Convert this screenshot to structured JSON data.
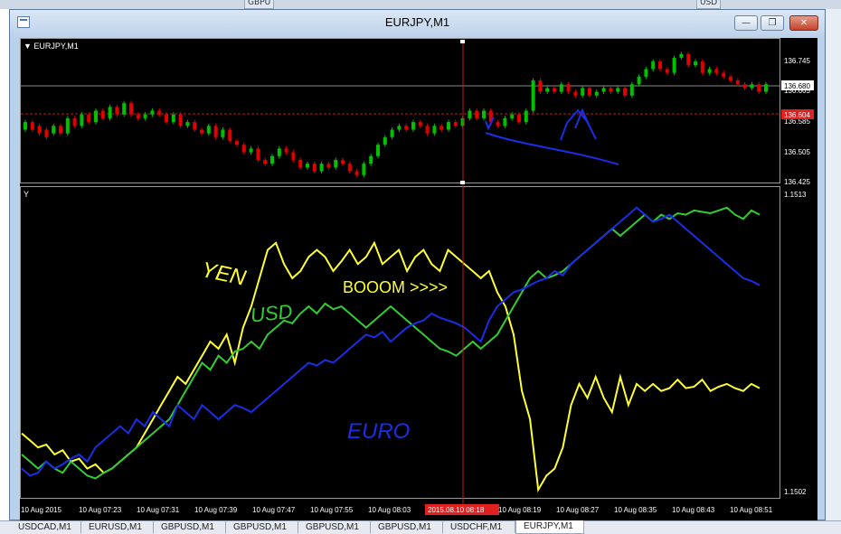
{
  "background_windows": [
    {
      "label": "GBPU"
    },
    {
      "label": "USD"
    }
  ],
  "window": {
    "title": "EURJPY,M1",
    "buttons": {
      "minimize": "—",
      "restore": "❐",
      "close": "✕"
    }
  },
  "price_chart": {
    "label": "▼ EURJPY,M1",
    "bid_label": "136.680",
    "ask_label": "136.604",
    "price_axis": [
      "136.745",
      "136.665",
      "136.585",
      "136.505",
      "136.425"
    ],
    "candles": [
      [
        136.56,
        136.58
      ],
      [
        136.58,
        136.56
      ],
      [
        136.57,
        136.55
      ],
      [
        136.56,
        136.54
      ],
      [
        136.55,
        136.57
      ],
      [
        136.57,
        136.55
      ],
      [
        136.55,
        136.59
      ],
      [
        136.59,
        136.57
      ],
      [
        136.57,
        136.6
      ],
      [
        136.6,
        136.58
      ],
      [
        136.58,
        136.61
      ],
      [
        136.61,
        136.59
      ],
      [
        136.59,
        136.62
      ],
      [
        136.62,
        136.6
      ],
      [
        136.6,
        136.63
      ],
      [
        136.63,
        136.6
      ],
      [
        136.6,
        136.59
      ],
      [
        136.59,
        136.6
      ],
      [
        136.6,
        136.61
      ],
      [
        136.61,
        136.6
      ],
      [
        136.6,
        136.58
      ],
      [
        136.58,
        136.6
      ],
      [
        136.6,
        136.57
      ],
      [
        136.57,
        136.58
      ],
      [
        136.58,
        136.56
      ],
      [
        136.56,
        136.55
      ],
      [
        136.55,
        136.57
      ],
      [
        136.57,
        136.54
      ],
      [
        136.54,
        136.56
      ],
      [
        136.56,
        136.53
      ],
      [
        136.53,
        136.52
      ],
      [
        136.52,
        136.5
      ],
      [
        136.5,
        136.51
      ],
      [
        136.51,
        136.48
      ],
      [
        136.48,
        136.47
      ],
      [
        136.47,
        136.49
      ],
      [
        136.49,
        136.51
      ],
      [
        136.51,
        136.5
      ],
      [
        136.5,
        136.48
      ],
      [
        136.48,
        136.46
      ],
      [
        136.46,
        136.47
      ],
      [
        136.47,
        136.45
      ],
      [
        136.45,
        136.47
      ],
      [
        136.47,
        136.46
      ],
      [
        136.46,
        136.48
      ],
      [
        136.48,
        136.47
      ],
      [
        136.47,
        136.45
      ],
      [
        136.45,
        136.44
      ],
      [
        136.44,
        136.47
      ],
      [
        136.47,
        136.49
      ],
      [
        136.49,
        136.52
      ],
      [
        136.52,
        136.54
      ],
      [
        136.54,
        136.56
      ],
      [
        136.56,
        136.57
      ],
      [
        136.57,
        136.56
      ],
      [
        136.56,
        136.58
      ],
      [
        136.58,
        136.57
      ],
      [
        136.57,
        136.55
      ],
      [
        136.55,
        136.57
      ],
      [
        136.57,
        136.56
      ],
      [
        136.56,
        136.58
      ],
      [
        136.58,
        136.57
      ],
      [
        136.57,
        136.59
      ],
      [
        136.59,
        136.61
      ],
      [
        136.61,
        136.59
      ],
      [
        136.59,
        136.61
      ],
      [
        136.61,
        136.58
      ],
      [
        136.58,
        136.57
      ],
      [
        136.57,
        136.59
      ],
      [
        136.59,
        136.6
      ],
      [
        136.6,
        136.58
      ],
      [
        136.58,
        136.61
      ],
      [
        136.61,
        136.69
      ],
      [
        136.69,
        136.66
      ],
      [
        136.66,
        136.67
      ],
      [
        136.67,
        136.66
      ],
      [
        136.66,
        136.68
      ],
      [
        136.68,
        136.66
      ],
      [
        136.66,
        136.65
      ],
      [
        136.65,
        136.67
      ],
      [
        136.67,
        136.65
      ],
      [
        136.65,
        136.66
      ],
      [
        136.66,
        136.67
      ],
      [
        136.67,
        136.66
      ],
      [
        136.66,
        136.67
      ],
      [
        136.67,
        136.65
      ],
      [
        136.65,
        136.68
      ],
      [
        136.68,
        136.7
      ],
      [
        136.7,
        136.72
      ],
      [
        136.72,
        136.74
      ],
      [
        136.74,
        136.72
      ],
      [
        136.72,
        136.71
      ],
      [
        136.71,
        136.75
      ],
      [
        136.75,
        136.76
      ],
      [
        136.76,
        136.73
      ],
      [
        136.73,
        136.74
      ],
      [
        136.74,
        136.71
      ],
      [
        136.71,
        136.72
      ],
      [
        136.72,
        136.71
      ],
      [
        136.71,
        136.7
      ],
      [
        136.7,
        136.69
      ],
      [
        136.69,
        136.68
      ],
      [
        136.68,
        136.67
      ],
      [
        136.67,
        136.68
      ],
      [
        136.68,
        136.66
      ],
      [
        136.66,
        136.68
      ]
    ]
  },
  "indicator": {
    "label": "Y",
    "scale_max": "1.1513",
    "scale_min": "1.1502",
    "series": {
      "yen": [
        -0.3,
        -0.35,
        -0.4,
        -0.38,
        -0.45,
        -0.42,
        -0.5,
        -0.48,
        -0.55,
        -0.52,
        -0.58,
        -0.55,
        -0.5,
        -0.45,
        -0.4,
        -0.3,
        -0.2,
        -0.1,
        0.0,
        0.1,
        0.05,
        0.15,
        0.25,
        0.35,
        0.3,
        0.4,
        0.2,
        0.45,
        0.6,
        0.8,
        1.0,
        1.05,
        0.9,
        0.8,
        0.85,
        0.95,
        1.0,
        0.95,
        0.85,
        0.92,
        1.0,
        0.9,
        0.95,
        1.05,
        0.9,
        0.95,
        1.0,
        0.85,
        0.95,
        1.0,
        0.9,
        0.85,
        1.0,
        0.95,
        0.9,
        0.85,
        0.8,
        0.85,
        0.7,
        0.6,
        0.4,
        0.0,
        -0.2,
        -0.7,
        -0.6,
        -0.55,
        -0.4,
        -0.1,
        0.05,
        -0.05,
        0.1,
        -0.05,
        -0.15,
        0.1,
        -0.1,
        0.05,
        0.0,
        0.05,
        0.0,
        0.02,
        0.08,
        0.02,
        0.03,
        0.08,
        0.0,
        0.03,
        0.05,
        0.02,
        0.0,
        0.05,
        0.02
      ],
      "usd": [
        -0.45,
        -0.5,
        -0.55,
        -0.5,
        -0.55,
        -0.58,
        -0.5,
        -0.55,
        -0.6,
        -0.62,
        -0.58,
        -0.55,
        -0.5,
        -0.45,
        -0.4,
        -0.35,
        -0.3,
        -0.25,
        -0.2,
        -0.1,
        0.0,
        0.1,
        0.2,
        0.15,
        0.25,
        0.2,
        0.28,
        0.3,
        0.35,
        0.3,
        0.4,
        0.45,
        0.5,
        0.48,
        0.55,
        0.6,
        0.55,
        0.62,
        0.58,
        0.6,
        0.55,
        0.5,
        0.45,
        0.5,
        0.55,
        0.6,
        0.55,
        0.5,
        0.45,
        0.4,
        0.35,
        0.3,
        0.28,
        0.25,
        0.3,
        0.35,
        0.3,
        0.35,
        0.4,
        0.5,
        0.6,
        0.7,
        0.8,
        0.85,
        0.8,
        0.82,
        0.85,
        0.9,
        0.95,
        1.0,
        1.05,
        1.1,
        1.15,
        1.1,
        1.15,
        1.2,
        1.25,
        1.2,
        1.25,
        1.22,
        1.26,
        1.25,
        1.28,
        1.27,
        1.26,
        1.28,
        1.3,
        1.25,
        1.22,
        1.28,
        1.25
      ],
      "euro": [
        -0.55,
        -0.6,
        -0.58,
        -0.5,
        -0.55,
        -0.52,
        -0.48,
        -0.45,
        -0.5,
        -0.4,
        -0.35,
        -0.3,
        -0.25,
        -0.3,
        -0.2,
        -0.25,
        -0.15,
        -0.2,
        -0.25,
        -0.1,
        -0.15,
        -0.2,
        -0.1,
        -0.15,
        -0.2,
        -0.15,
        -0.1,
        -0.12,
        -0.15,
        -0.1,
        -0.05,
        0.0,
        0.05,
        0.1,
        0.15,
        0.2,
        0.18,
        0.22,
        0.2,
        0.25,
        0.3,
        0.35,
        0.4,
        0.38,
        0.42,
        0.35,
        0.4,
        0.45,
        0.48,
        0.5,
        0.55,
        0.52,
        0.5,
        0.48,
        0.45,
        0.4,
        0.35,
        0.5,
        0.6,
        0.65,
        0.7,
        0.72,
        0.75,
        0.78,
        0.8,
        0.85,
        0.82,
        0.9,
        0.95,
        1.0,
        1.05,
        1.1,
        1.15,
        1.2,
        1.25,
        1.3,
        1.25,
        1.2,
        1.22,
        1.25,
        1.2,
        1.15,
        1.1,
        1.05,
        1.0,
        0.95,
        0.9,
        0.85,
        0.8,
        0.78,
        0.75
      ]
    }
  },
  "annotations": {
    "yen": "YEN",
    "usd": "USD",
    "euro": "EURO",
    "booom": "BOOOM >>>>"
  },
  "time_axis": [
    "10 Aug 2015",
    "10 Aug 07:23",
    "10 Aug 07:31",
    "10 Aug 07:39",
    "10 Aug 07:47",
    "10 Aug 07:55",
    "10 Aug 08:03",
    "2015.08.10 08:18",
    "10 Aug 08:19",
    "10 Aug 08:27",
    "10 Aug 08:35",
    "10 Aug 08:43",
    "10 Aug 08:51"
  ],
  "tabs": [
    "USDCAD,M1",
    "EURUSD,M1",
    "GBPUSD,M1",
    "GBPUSD,M1",
    "GBPUSD,M1",
    "GBPUSD,M1",
    "USDCHF,M1",
    "EURJPY,M1"
  ],
  "active_tab": "EURJPY,M1",
  "colors": {
    "bull": "#00c000",
    "bear": "#e00000",
    "yen": "#ffff33",
    "usd": "#33cc33",
    "euro": "#1a2ee6",
    "ink": "#1a2ee6",
    "crosshair": "#c01a1a"
  }
}
